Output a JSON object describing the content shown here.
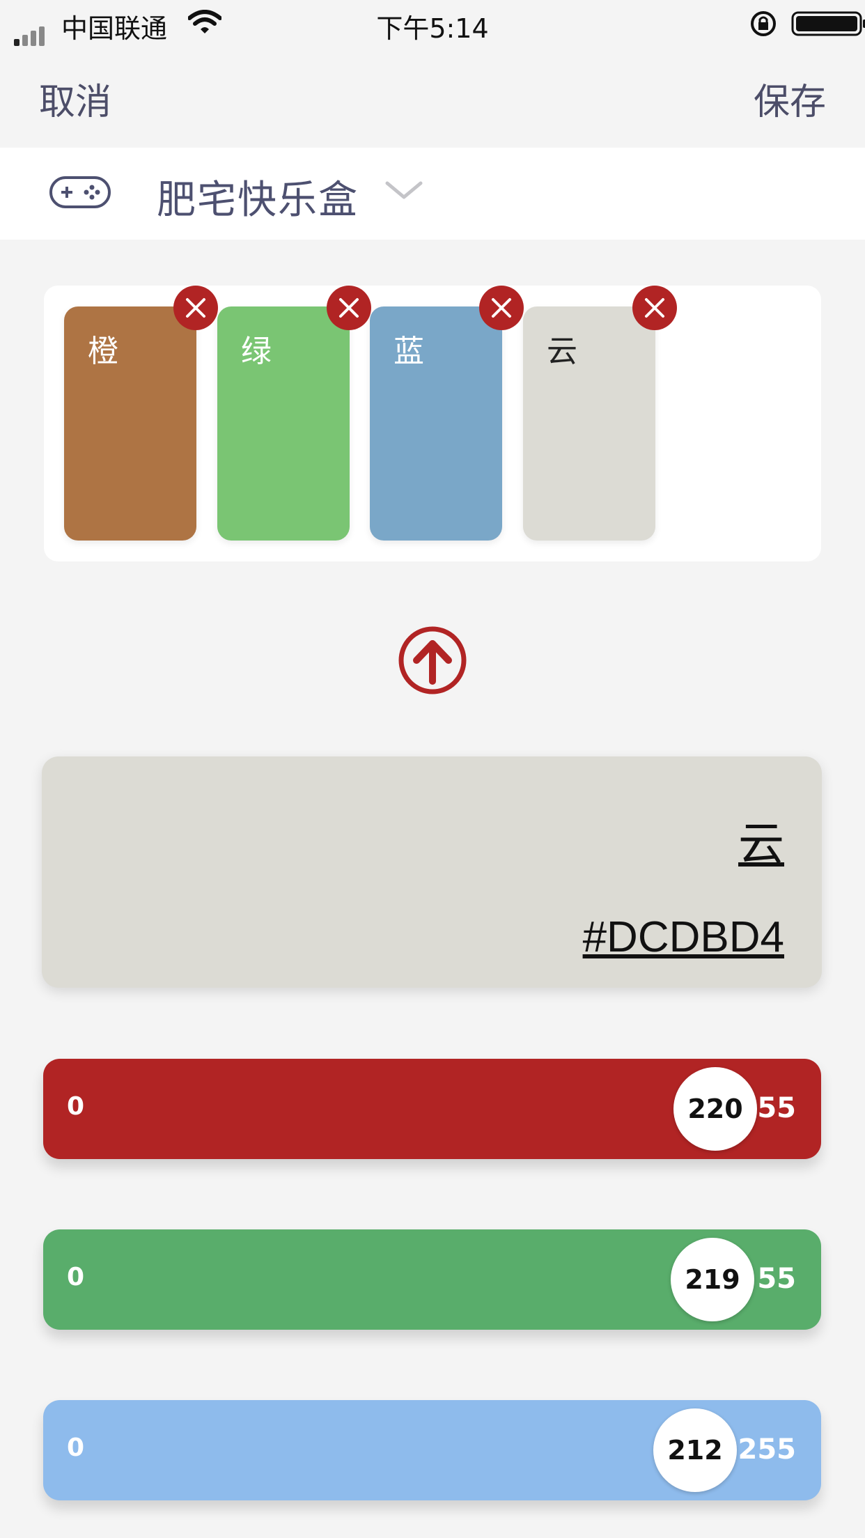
{
  "status_bar": {
    "carrier": "中国联通",
    "time": "下午5:14"
  },
  "nav": {
    "cancel_label": "取消",
    "save_label": "保存"
  },
  "selector": {
    "icon": "gamepad-icon",
    "title": "肥宅快乐盒"
  },
  "palette": {
    "swatches": [
      {
        "label": "橙",
        "color": "#ae7444"
      },
      {
        "label": "绿",
        "color": "#7ac573"
      },
      {
        "label": "蓝",
        "color": "#7aa7c8"
      },
      {
        "label": "云",
        "color": "#dcdbd4"
      }
    ]
  },
  "preview": {
    "name": "云",
    "hex": "#DCDBD4",
    "color": "#dcdbd4"
  },
  "sliders": [
    {
      "channel": "red",
      "min": "0",
      "max": "55",
      "value": "220",
      "color": "#b12424"
    },
    {
      "channel": "green",
      "min": "0",
      "max": "55",
      "value": "219",
      "color": "#59ad6b"
    },
    {
      "channel": "blue",
      "min": "0",
      "max": "255",
      "value": "212",
      "color": "#8ebbec"
    }
  ]
}
